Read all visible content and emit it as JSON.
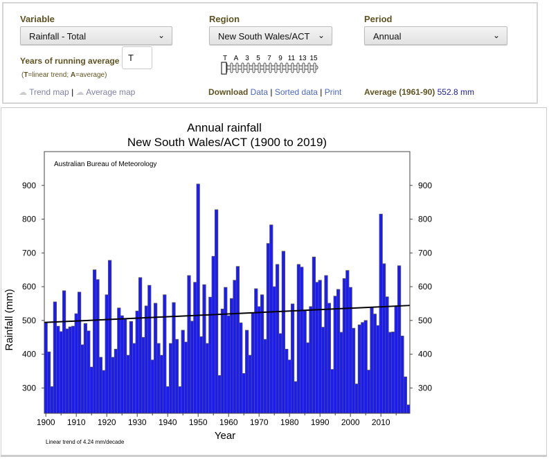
{
  "controls": {
    "variable_label": "Variable",
    "variable_value": "Rainfall - Total",
    "region_label": "Region",
    "region_value": "New South Wales/ACT",
    "period_label": "Period",
    "period_value": "Annual",
    "running_avg_label": "Years of running average",
    "running_avg_value": "T",
    "hint_T": "T",
    "hint_T_text": "=linear trend; ",
    "hint_A": "A",
    "hint_A_text": "=average)",
    "hint_open": "(",
    "trend_map": "Trend map",
    "sep": "|",
    "average_map": "Average map",
    "download_label": "Download",
    "data_link": "Data",
    "sorted_link": "Sorted data",
    "print_link": "Print",
    "average_label": "Average (1961-90)",
    "average_value": "552.8 mm",
    "slider_labels": [
      "T",
      "A",
      "3",
      "5",
      "7",
      "9",
      "11",
      "13",
      "15"
    ],
    "slider_selected": "T"
  },
  "colors": {
    "bar": "#1a1aff",
    "bar_edge": "#555555",
    "label": "#5f5220",
    "link": "#4a67c4",
    "average_value": "#1a1aa0"
  },
  "chart_data": {
    "type": "bar",
    "title": "Annual rainfall",
    "subtitle": "New South Wales/ACT (1900 to 2019)",
    "xlabel": "Year",
    "ylabel": "Rainfall (mm)",
    "credit": "Australian Bureau of Meteorology",
    "footnote": "Linear trend of 4.24 mm/decade",
    "ylim": [
      225,
      1000
    ],
    "xlim": [
      1900,
      2019
    ],
    "yticks": [
      300,
      400,
      500,
      600,
      700,
      800,
      900
    ],
    "xticks": [
      1900,
      1910,
      1920,
      1930,
      1940,
      1950,
      1960,
      1970,
      1980,
      1990,
      2000,
      2010
    ],
    "start_year": 1900,
    "values": [
      493,
      407,
      304,
      555,
      483,
      467,
      588,
      475,
      481,
      483,
      520,
      584,
      428,
      491,
      469,
      362,
      650,
      621,
      391,
      352,
      576,
      678,
      391,
      415,
      537,
      514,
      504,
      397,
      497,
      432,
      528,
      627,
      450,
      543,
      604,
      383,
      551,
      432,
      397,
      576,
      304,
      432,
      553,
      444,
      304,
      471,
      436,
      633,
      498,
      613,
      904,
      452,
      606,
      432,
      569,
      690,
      828,
      337,
      534,
      598,
      514,
      565,
      619,
      660,
      493,
      343,
      471,
      397,
      522,
      594,
      541,
      576,
      444,
      728,
      783,
      600,
      666,
      461,
      705,
      415,
      383,
      549,
      319,
      666,
      658,
      530,
      434,
      541,
      688,
      613,
      619,
      480,
      633,
      551,
      355,
      572,
      592,
      465,
      624,
      648,
      598,
      477,
      312,
      487,
      494,
      500,
      353,
      540,
      519,
      485,
      815,
      668,
      570,
      465,
      466,
      541,
      662,
      454,
      333,
      250
    ],
    "trend": {
      "start_value": 494,
      "slope_per_decade": 4.24,
      "start_year": 1900,
      "end_year": 2019
    }
  }
}
